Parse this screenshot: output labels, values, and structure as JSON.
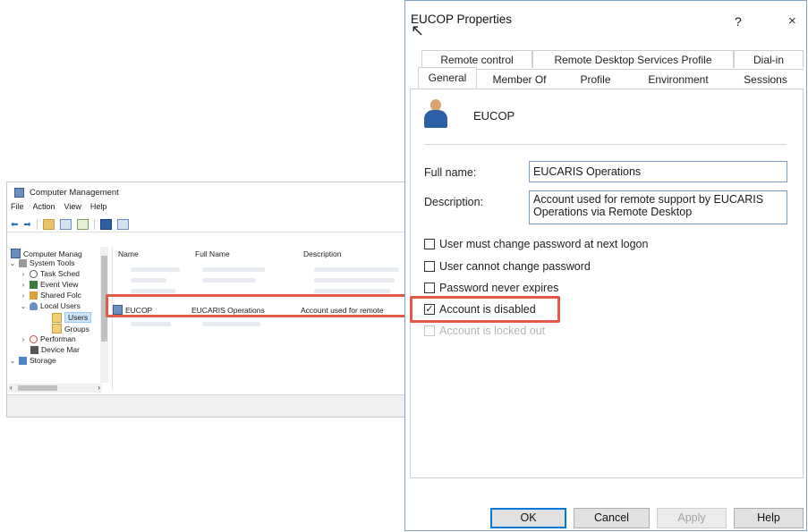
{
  "cm": {
    "title": "Computer Management",
    "menu": [
      "File",
      "Action",
      "View",
      "Help"
    ],
    "tree": {
      "root": "Computer Manag",
      "system_tools": "System Tools",
      "task_scheduler": "Task Sched",
      "event_viewer": "Event View",
      "shared_folders": "Shared Folc",
      "local_users": "Local Users",
      "users": "Users",
      "groups": "Groups",
      "performance": "Performan",
      "device_manager": "Device Mar",
      "storage": "Storage"
    },
    "columns": [
      "Name",
      "Full Name",
      "Description"
    ],
    "highlighted_row": {
      "name": "EUCOP",
      "full_name": "EUCARIS Operations",
      "description": "Account used for remote"
    }
  },
  "dialog": {
    "title": "EUCOP Properties",
    "help_glyph": "?",
    "close_glyph": "×",
    "tabs_back": [
      "Remote control",
      "Remote Desktop Services Profile",
      "Dial-in"
    ],
    "tabs_front": [
      "General",
      "Member Of",
      "Profile",
      "Environment",
      "Sessions"
    ],
    "active_tab": "General",
    "user_name": "EUCOP",
    "full_name_label": "Full name:",
    "full_name_value": "EUCARIS Operations",
    "description_label": "Description:",
    "description_line1": "Account used for remote support by EUCARIS",
    "description_line2": "Operations via Remote Desktop",
    "checkboxes": {
      "must_change": {
        "label": "User must change password at next logon",
        "checked": false
      },
      "cannot_change": {
        "label": "User cannot change password",
        "checked": false
      },
      "never_expires": {
        "label": "Password never expires",
        "checked": false
      },
      "disabled": {
        "label": "Account is disabled",
        "checked": true
      },
      "locked_out": {
        "label": "Account is locked out",
        "checked": false
      }
    },
    "buttons": {
      "ok": "OK",
      "cancel": "Cancel",
      "apply": "Apply",
      "help": "Help"
    }
  },
  "colors": {
    "callout": "#e05a47",
    "selection": "#cce4f7",
    "focus": "#0078d7"
  }
}
